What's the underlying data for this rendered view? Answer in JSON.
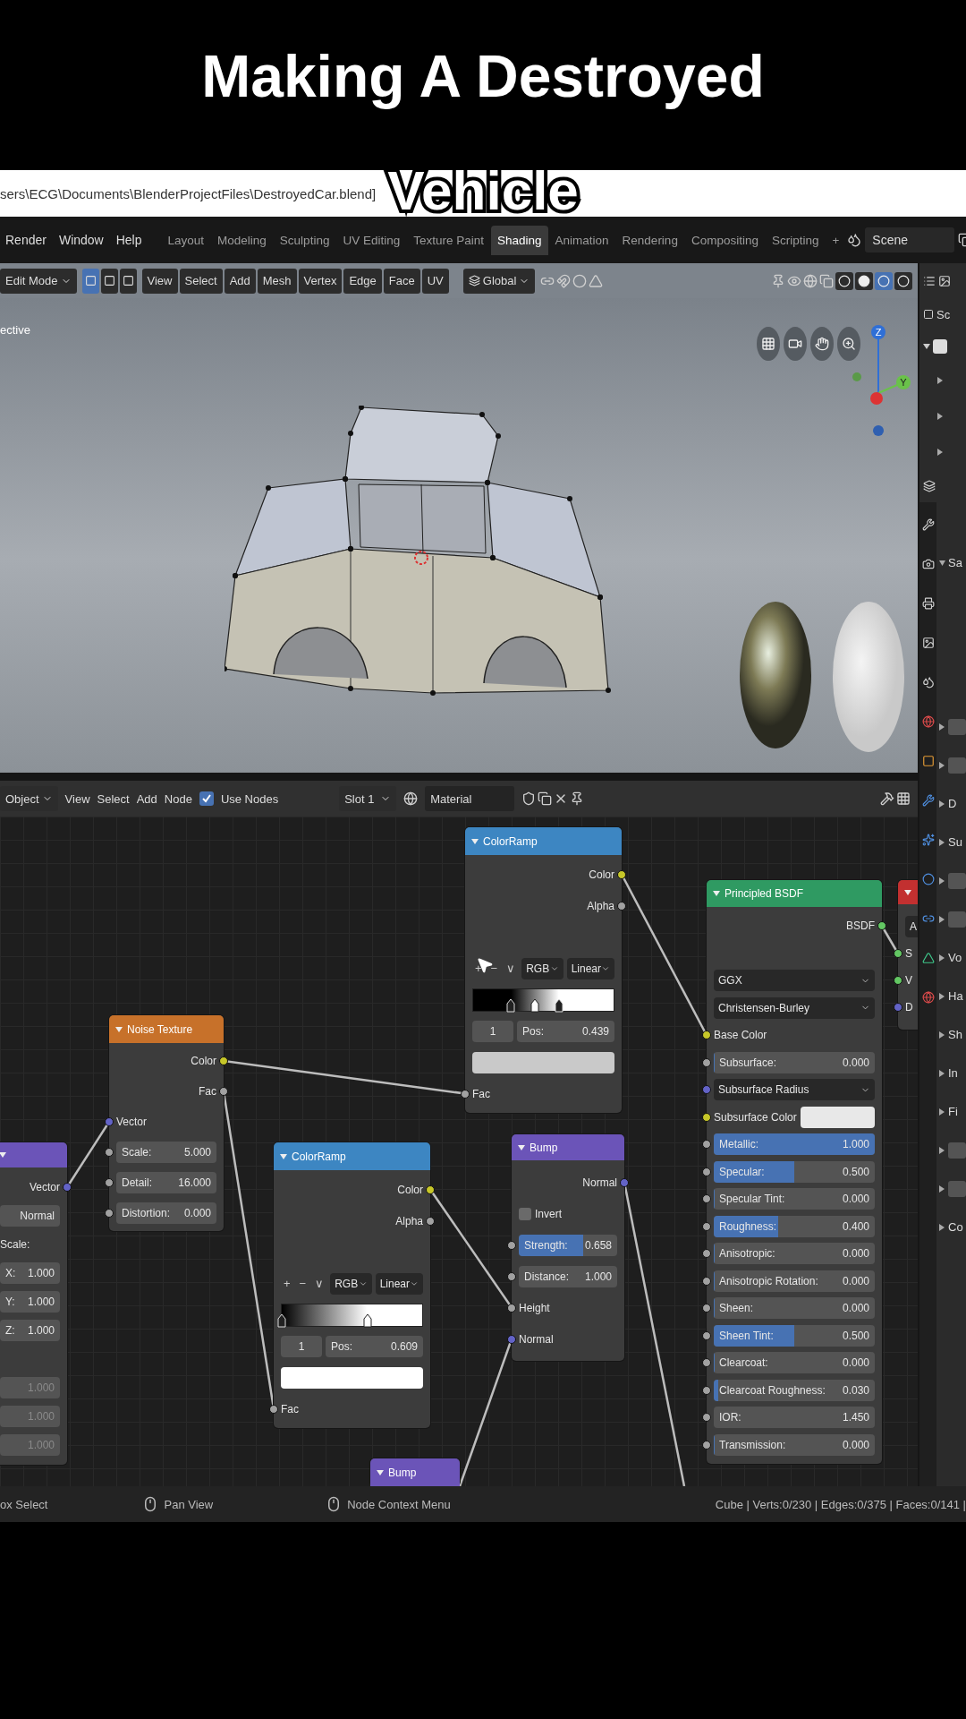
{
  "caption": {
    "line_1": "Making A Destroyed",
    "line_2": "Vehicle"
  },
  "window": {
    "title": "sers\\ECG\\Documents\\BlenderProjectFiles\\DestroyedCar.blend]"
  },
  "menu": [
    "Render",
    "Window",
    "Help"
  ],
  "workspaces": [
    {
      "label": "Layout",
      "selected": false
    },
    {
      "label": "Modeling",
      "selected": false
    },
    {
      "label": "Sculpting",
      "selected": false
    },
    {
      "label": "UV Editing",
      "selected": false
    },
    {
      "label": "Texture Paint",
      "selected": false
    },
    {
      "label": "Shading",
      "selected": true
    },
    {
      "label": "Animation",
      "selected": false
    },
    {
      "label": "Rendering",
      "selected": false
    },
    {
      "label": "Compositing",
      "selected": false
    },
    {
      "label": "Scripting",
      "selected": false
    }
  ],
  "workspace_add": "+",
  "scene": "Scene",
  "viewport_header": {
    "mode": "Edit Mode",
    "select_modes": [
      {
        "selected": true
      },
      {
        "selected": false
      },
      {
        "selected": false
      }
    ],
    "menus": [
      "View",
      "Select",
      "Add",
      "Mesh",
      "Vertex",
      "Edge",
      "Face",
      "UV"
    ],
    "orientation": "Global",
    "shading_modes": [
      {
        "selected": false
      },
      {
        "selected": false
      },
      {
        "selected": true
      },
      {
        "selected": false
      }
    ]
  },
  "viewport": {
    "view_label": "ective",
    "gizmo_axes": [
      "Z",
      "Y"
    ]
  },
  "node_header": {
    "object": "Object",
    "menus": [
      "View",
      "Select",
      "Add",
      "Node"
    ],
    "use_nodes": {
      "label": "Use Nodes",
      "checked": true
    },
    "slot": "Slot 1",
    "material": "Material"
  },
  "nodes": [
    {
      "color": "#6b54b8",
      "rows": [
        {
          "kind": "output",
          "label": "Vector",
          "color": "#6363c7"
        },
        {
          "kind": "button",
          "label": "Normal"
        },
        {
          "kind": "label",
          "label": "Scale:"
        },
        {
          "kind": "field",
          "label": "X:",
          "value": "1.000",
          "disabled": false
        },
        {
          "kind": "field",
          "label": "Y:",
          "value": "1.000",
          "disabled": false
        },
        {
          "kind": "field",
          "label": "Z:",
          "value": "1.000",
          "disabled": false
        },
        {
          "kind": "spacer"
        },
        {
          "kind": "field",
          "value": "1.000",
          "disabled": true
        },
        {
          "kind": "field",
          "value": "1.000",
          "disabled": true
        },
        {
          "kind": "field",
          "value": "1.000",
          "disabled": true
        }
      ]
    },
    {
      "title": "Noise Texture",
      "color": "#c7712a",
      "rows": [
        {
          "kind": "output",
          "label": "Color",
          "color": "#c7c729"
        },
        {
          "kind": "output",
          "label": "Fac",
          "color": "#a1a1a1"
        },
        {
          "kind": "input",
          "label": "Vector",
          "color": "#6363c7"
        },
        {
          "kind": "field",
          "label": "Scale:",
          "value": "5.000",
          "color": "#a1a1a1"
        },
        {
          "kind": "field",
          "label": "Detail:",
          "value": "16.000",
          "color": "#a1a1a1"
        },
        {
          "kind": "field",
          "label": "Distortion:",
          "value": "0.000",
          "color": "#a1a1a1"
        }
      ]
    },
    {
      "title": "ColorRamp",
      "color": "#3d86c2",
      "rows": [
        {
          "kind": "output",
          "label": "Color",
          "color": "#c7c729"
        },
        {
          "kind": "output",
          "label": "Alpha",
          "color": "#a1a1a1"
        },
        {
          "kind": "spacer"
        },
        {
          "kind": "ramp_tools",
          "tools": [
            "+",
            "−",
            "∨"
          ],
          "mode": "RGB",
          "interpolation": "Linear"
        },
        {
          "kind": "ramp_bar",
          "stops": [
            {
              "level": 0.27,
              "selected": false
            },
            {
              "level": 0.44,
              "selected": true
            },
            {
              "level": 0.61,
              "selected": false
            }
          ]
        },
        {
          "kind": "ramp_stop",
          "index": "1",
          "label": "Pos:",
          "value": "0.439"
        },
        {
          "kind": "swatch",
          "swatch": {
            "color": "#c9c9c9"
          }
        },
        {
          "kind": "input",
          "label": "Fac",
          "color": "#a1a1a1"
        }
      ]
    },
    {
      "title": "ColorRamp",
      "color": "#3d86c2",
      "rows": [
        {
          "kind": "output",
          "label": "Color",
          "color": "#c7c729"
        },
        {
          "kind": "output",
          "label": "Alpha",
          "color": "#a1a1a1"
        },
        {
          "kind": "spacer"
        },
        {
          "kind": "ramp_tools",
          "tools": [
            "+",
            "−",
            "∨"
          ],
          "mode": "RGB",
          "interpolation": "Linear"
        },
        {
          "kind": "ramp_bar",
          "stops": [
            {
              "level": 0.0,
              "selected": false
            },
            {
              "level": 0.609,
              "selected": true
            }
          ]
        },
        {
          "kind": "ramp_stop",
          "index": "1",
          "label": "Pos:",
          "value": "0.609"
        },
        {
          "kind": "swatch",
          "swatch": {
            "color": "#ffffff"
          }
        },
        {
          "kind": "input",
          "label": "Fac",
          "color": "#a1a1a1"
        }
      ]
    },
    {
      "title": "Bump",
      "color": "#6b54b8",
      "rows": [
        {
          "kind": "output",
          "label": "Normal",
          "color": "#6363c7"
        },
        {
          "kind": "checkbox",
          "label": "Invert",
          "checked": false
        },
        {
          "kind": "slider",
          "label": "Strength:",
          "value": "0.658",
          "level": 0.658,
          "color": "#a1a1a1"
        },
        {
          "kind": "field",
          "label": "Distance:",
          "value": "1.000",
          "color": "#a1a1a1"
        },
        {
          "kind": "input",
          "label": "Height",
          "color": "#a1a1a1"
        },
        {
          "kind": "input",
          "label": "Normal",
          "color": "#6363c7"
        }
      ]
    },
    {
      "title": "Bump",
      "color": "#6b54b8"
    },
    {
      "title": "Principled BSDF",
      "color": "#2f9a62",
      "rows": [
        {
          "kind": "output",
          "label": "BSDF",
          "color": "#63c763"
        },
        {
          "kind": "spacer"
        },
        {
          "kind": "dropdown",
          "label": "GGX"
        },
        {
          "kind": "dropdown",
          "label": "Christensen-Burley"
        },
        {
          "kind": "input",
          "label": "Base Color",
          "color": "#c7c729"
        },
        {
          "kind": "slider",
          "label": "Subsurface:",
          "value": "0.000",
          "level": 0,
          "color": "#a1a1a1"
        },
        {
          "kind": "dropdown",
          "label": "Subsurface Radius",
          "color": "#6363c7"
        },
        {
          "kind": "color",
          "label": "Subsurface Color",
          "swatch": {
            "color": "#e8e8e8"
          },
          "color": "#c7c729"
        },
        {
          "kind": "slider",
          "label": "Metallic:",
          "value": "1.000",
          "level": 1,
          "color": "#a1a1a1"
        },
        {
          "kind": "slider",
          "label": "Specular:",
          "value": "0.500",
          "level": 0.5,
          "color": "#a1a1a1"
        },
        {
          "kind": "slider",
          "label": "Specular Tint:",
          "value": "0.000",
          "level": 0,
          "color": "#a1a1a1"
        },
        {
          "kind": "slider",
          "label": "Roughness:",
          "value": "0.400",
          "level": 0.4,
          "color": "#a1a1a1"
        },
        {
          "kind": "slider",
          "label": "Anisotropic:",
          "value": "0.000",
          "level": 0,
          "color": "#a1a1a1"
        },
        {
          "kind": "slider",
          "label": "Anisotropic Rotation:",
          "value": "0.000",
          "level": 0,
          "color": "#a1a1a1"
        },
        {
          "kind": "slider",
          "label": "Sheen:",
          "value": "0.000",
          "level": 0,
          "color": "#a1a1a1"
        },
        {
          "kind": "slider",
          "label": "Sheen Tint:",
          "value": "0.500",
          "level": 0.5,
          "color": "#a1a1a1"
        },
        {
          "kind": "slider",
          "label": "Clearcoat:",
          "value": "0.000",
          "level": 0,
          "color": "#a1a1a1"
        },
        {
          "kind": "slider",
          "label": "Clearcoat Roughness:",
          "value": "0.030",
          "level": 0.03,
          "color": "#a1a1a1"
        },
        {
          "kind": "field",
          "label": "IOR:",
          "value": "1.450",
          "color": "#a1a1a1"
        },
        {
          "kind": "slider",
          "label": "Transmission:",
          "value": "0.000",
          "level": 0,
          "color": "#a1a1a1"
        }
      ]
    },
    {
      "color": "#c23030",
      "rows": [
        {
          "kind": "dropdown",
          "label": "A"
        },
        {
          "kind": "input",
          "label": "S",
          "color": "#63c763"
        },
        {
          "kind": "input",
          "label": "V",
          "color": "#63c763"
        },
        {
          "kind": "input",
          "label": "D",
          "color": "#6363c7"
        }
      ]
    }
  ],
  "properties": {
    "outliner_label": "Sc",
    "collection_checked": true,
    "sections": [
      {
        "kind": "section",
        "label": "Sa",
        "expanded": true
      },
      {
        "kind": "blank"
      },
      {
        "kind": "blank"
      },
      {
        "kind": "section",
        "label": "D",
        "expanded": false
      },
      {
        "kind": "section",
        "label": "Su",
        "expanded": false
      },
      {
        "kind": "blank"
      },
      {
        "kind": "blank"
      },
      {
        "kind": "section",
        "label": "Vo",
        "expanded": false
      },
      {
        "kind": "section",
        "label": "Ha",
        "expanded": false
      },
      {
        "kind": "section",
        "label": "Sh",
        "expanded": false
      },
      {
        "kind": "section",
        "label": "In",
        "expanded": false
      },
      {
        "kind": "section",
        "label": "Fi",
        "expanded": false
      },
      {
        "kind": "blank"
      },
      {
        "kind": "blank"
      },
      {
        "kind": "section",
        "label": "Co",
        "expanded": false
      }
    ]
  },
  "status_bar": {
    "hints": [
      {
        "kind": "plain",
        "label": "ox Select"
      },
      {
        "kind": "mouse",
        "label": "Pan View"
      },
      {
        "kind": "mouse",
        "label": "Node Context Menu"
      }
    ],
    "stats": "Cube | Verts:0/230 | Edges:0/375 | Faces:0/141 |"
  }
}
